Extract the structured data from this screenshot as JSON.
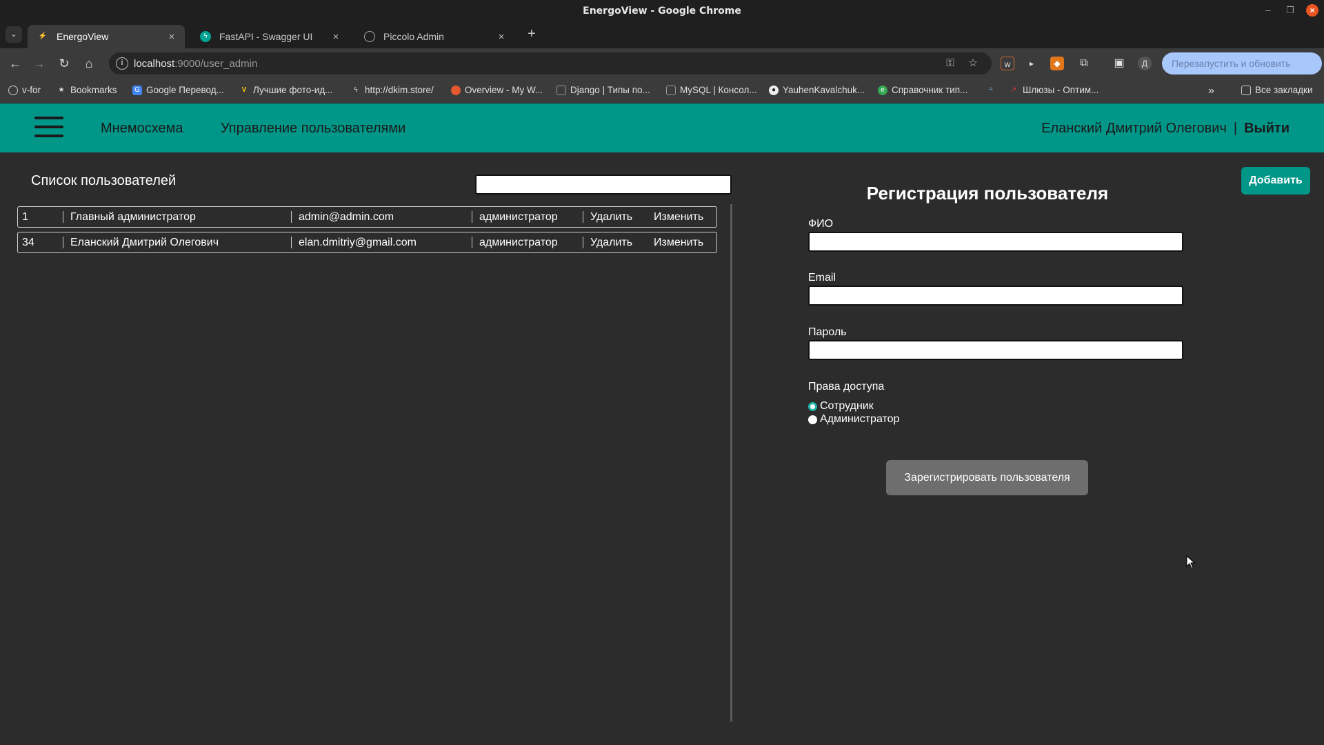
{
  "window": {
    "title": "EnergoView - Google Chrome"
  },
  "tabs": [
    {
      "label": "EnergoView",
      "active": true
    },
    {
      "label": "FastAPI - Swagger UI",
      "active": false
    },
    {
      "label": "Piccolo Admin",
      "active": false
    }
  ],
  "address_bar": {
    "host": "localhost",
    "path": ":9000/user_admin"
  },
  "relaunch_label": "Перезапустить и обновить",
  "bookmarks": [
    "v-for",
    "Bookmarks",
    "Google Перевод...",
    "Лучшие фото-ид...",
    "http://dkim.store/",
    "Overview - My W...",
    "Django | Типы по...",
    "MySQL | Консол...",
    "YauhenKavalchuk...",
    "Справочник тип...",
    "Шлюзы - Оптим..."
  ],
  "all_bookmarks_label": "Все закладки",
  "app": {
    "nav": {
      "mnemo": "Мнемосхема",
      "users": "Управление пользователями"
    },
    "user": {
      "name": "Еланский Дмитрий Олегович",
      "sep": "|",
      "logout": "Выйти"
    },
    "add_button": "Добавить",
    "list": {
      "title": "Список пользователей",
      "rows": [
        {
          "id": "1",
          "name": "Главный администратор",
          "email": "admin@admin.com",
          "role": "администратор",
          "delete": "Удалить",
          "edit": "Изменить"
        },
        {
          "id": "34",
          "name": "Еланский Дмитрий Олегович",
          "email": "elan.dmitriy@gmail.com",
          "role": "администратор",
          "delete": "Удалить",
          "edit": "Изменить"
        }
      ]
    },
    "registration": {
      "title": "Регистрация пользователя",
      "fio_label": "ФИО",
      "email_label": "Email",
      "password_label": "Пароль",
      "access_label": "Права доступа",
      "role_employee": "Сотрудник",
      "role_admin": "Администратор",
      "selected_role": "Сотрудник",
      "submit": "Зарегистрировать пользователя"
    }
  },
  "colors": {
    "teal": "#009688",
    "background": "#2c2c2c"
  }
}
